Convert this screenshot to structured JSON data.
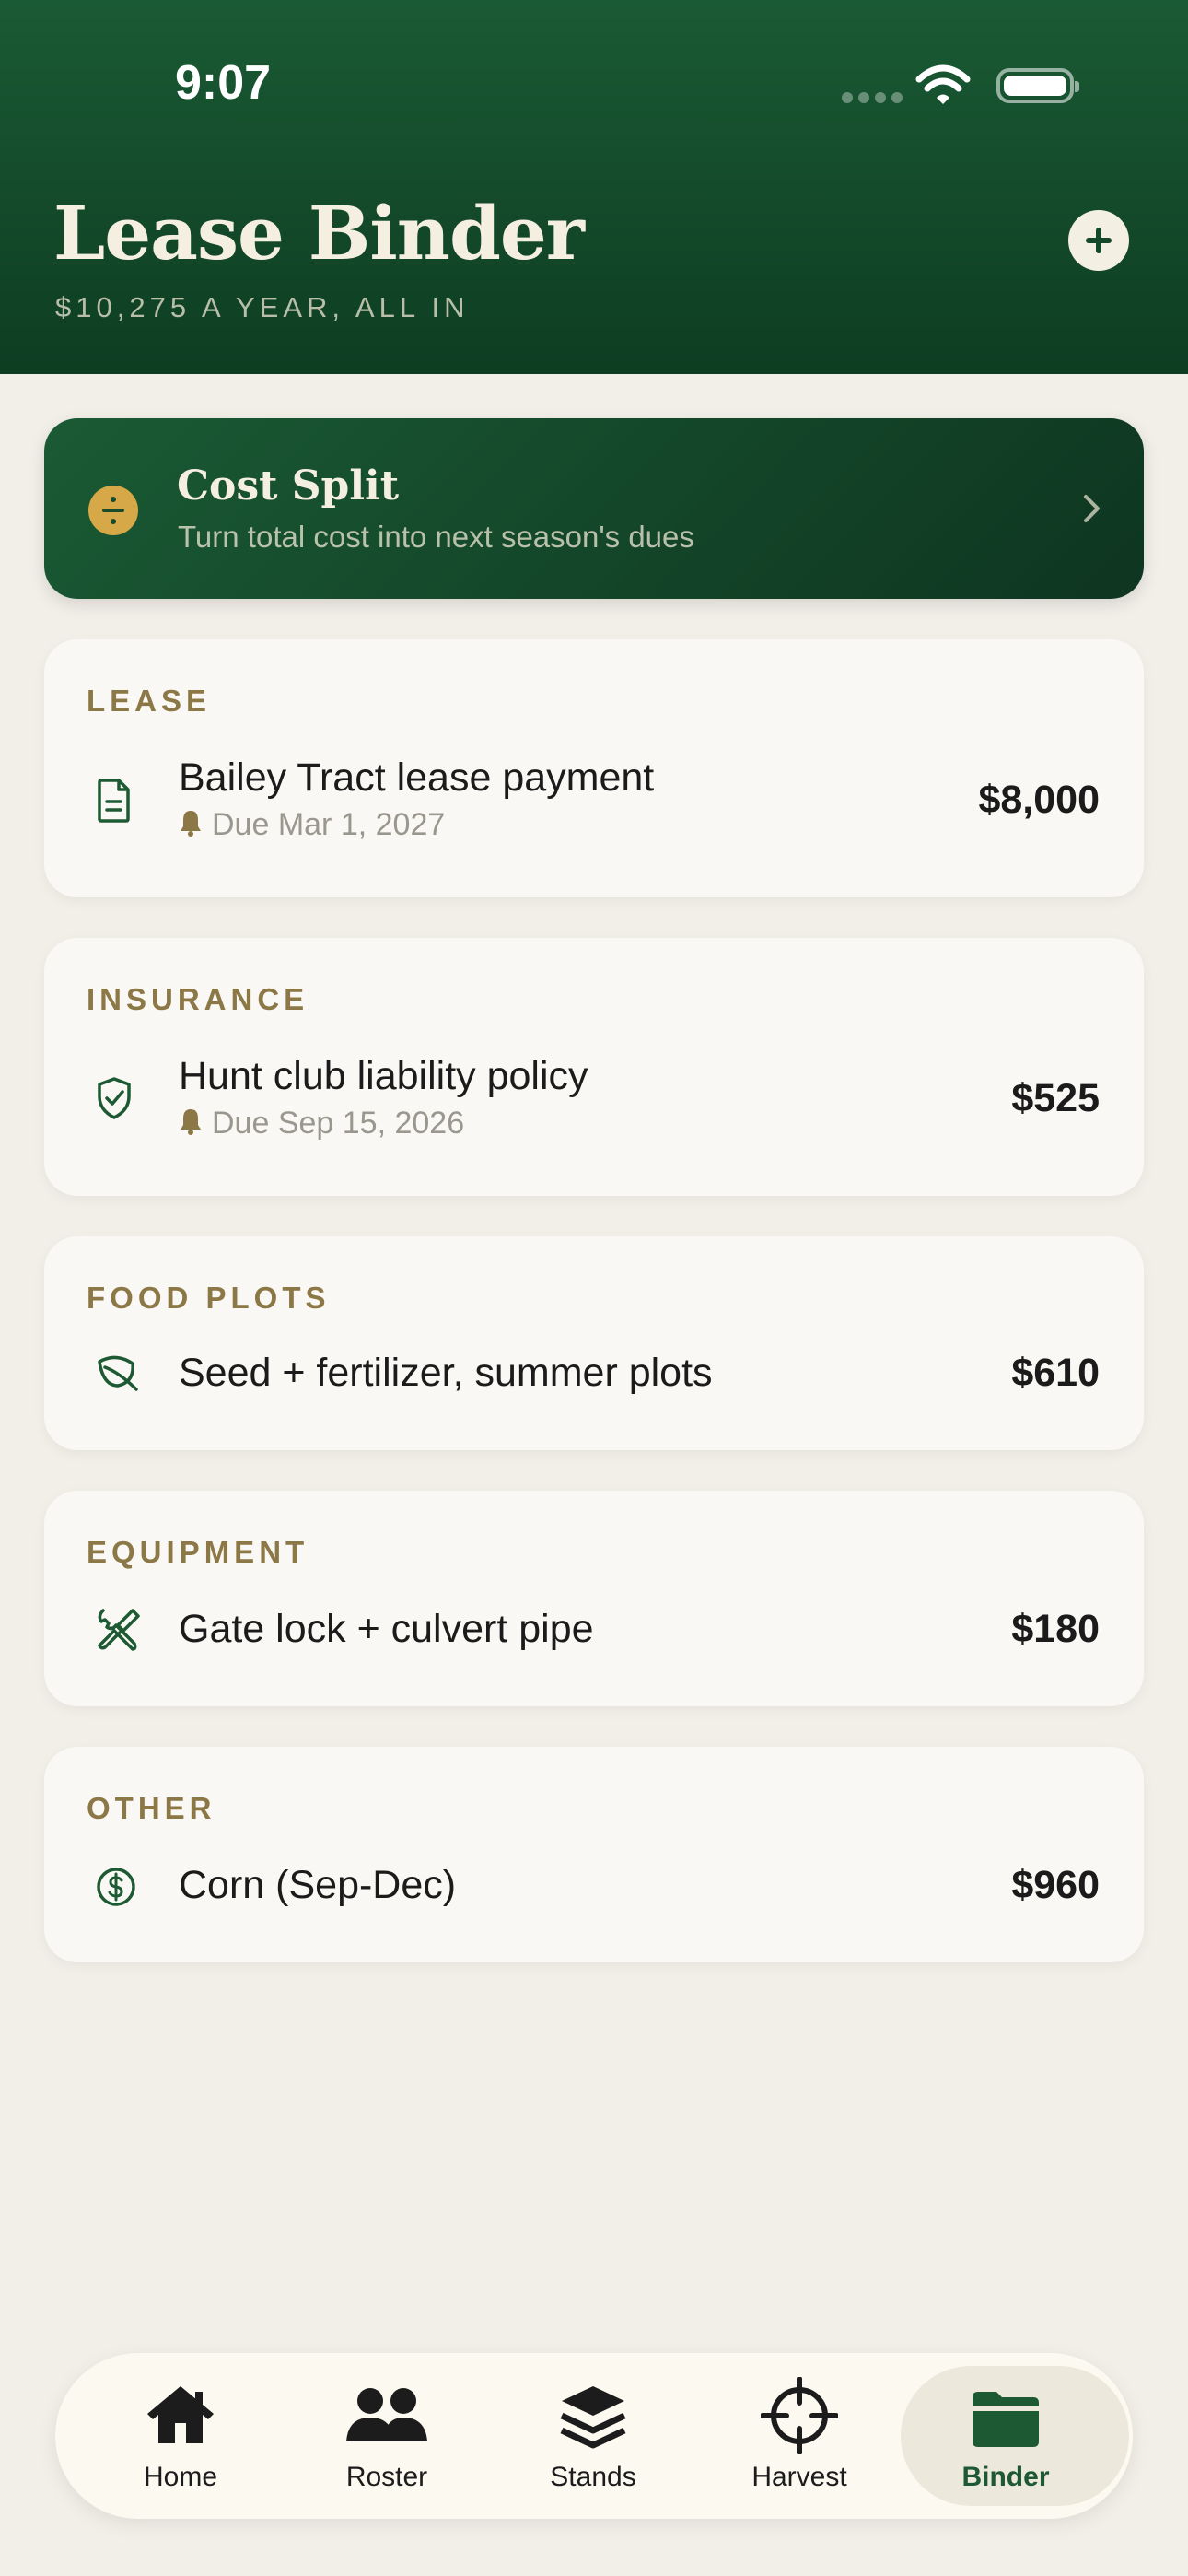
{
  "status": {
    "time": "9:07"
  },
  "header": {
    "title": "Lease Binder",
    "subtitle": "$10,275 A YEAR, ALL IN"
  },
  "cost_split": {
    "title": "Cost Split",
    "subtitle": "Turn total cost into next season's dues"
  },
  "categories": [
    {
      "label": "LEASE",
      "icon": "document-icon",
      "item": "Bailey Tract lease payment",
      "due": "Due Mar 1, 2027",
      "amount": "$8,000"
    },
    {
      "label": "INSURANCE",
      "icon": "shield-check-icon",
      "item": "Hunt club liability policy",
      "due": "Due Sep 15, 2026",
      "amount": "$525"
    },
    {
      "label": "FOOD PLOTS",
      "icon": "leaf-icon",
      "item": "Seed + fertilizer, summer plots",
      "amount": "$610"
    },
    {
      "label": "EQUIPMENT",
      "icon": "tools-icon",
      "item": "Gate lock + culvert pipe",
      "amount": "$180"
    },
    {
      "label": "OTHER",
      "icon": "dollar-circle-icon",
      "item": "Corn (Sep-Dec)",
      "amount": "$960"
    }
  ],
  "tabs": [
    {
      "label": "Home",
      "icon": "home-icon"
    },
    {
      "label": "Roster",
      "icon": "people-icon"
    },
    {
      "label": "Stands",
      "icon": "layers-icon"
    },
    {
      "label": "Harvest",
      "icon": "crosshair-icon"
    },
    {
      "label": "Binder",
      "icon": "folder-icon",
      "active": true
    }
  ],
  "colors": {
    "header_green": "#1a5a34",
    "accent_gold": "#d6a847",
    "category_label": "#8c7846",
    "background": "#f2efe8"
  }
}
